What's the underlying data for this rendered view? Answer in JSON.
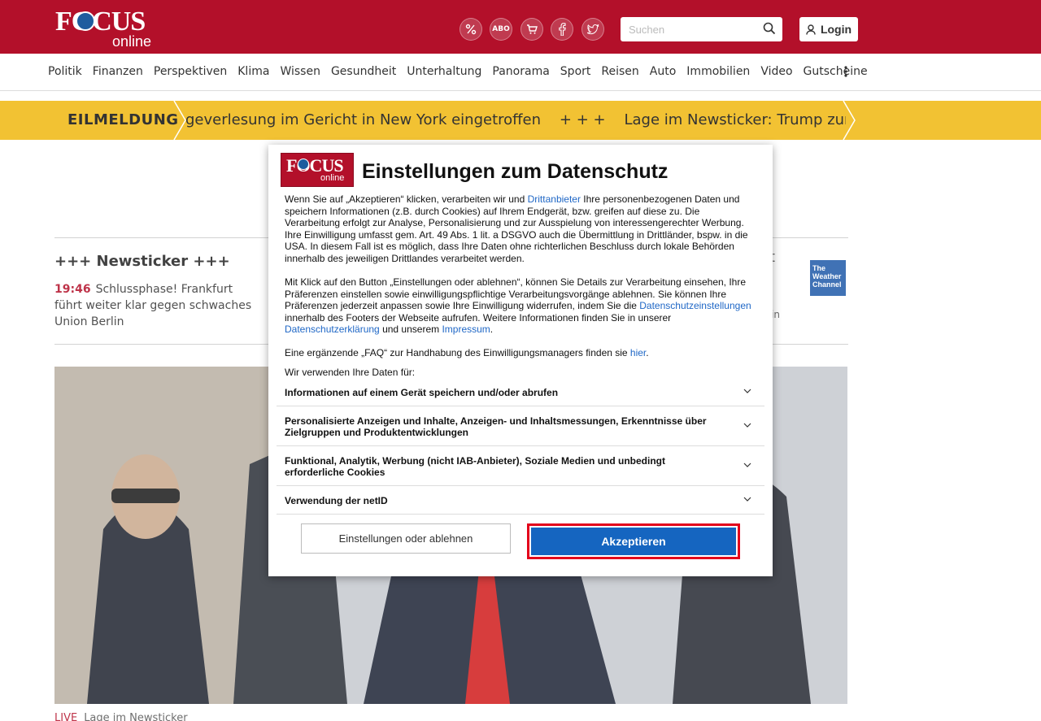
{
  "header": {
    "logo_main": "FOCUS",
    "logo_sub": "online",
    "icons": [
      {
        "name": "discount-icon",
        "glyph": "%"
      },
      {
        "name": "abo-icon",
        "glyph": "ABO"
      },
      {
        "name": "cart-icon",
        "glyph": "🛒"
      },
      {
        "name": "facebook-icon",
        "glyph": "f"
      },
      {
        "name": "twitter-icon",
        "glyph": "t"
      }
    ],
    "search_placeholder": "Suchen",
    "login_label": "Login",
    "brand_color": "#b3102a"
  },
  "nav": {
    "items": [
      "Politik",
      "Finanzen",
      "Perspektiven",
      "Klima",
      "Wissen",
      "Gesundheit",
      "Unterhaltung",
      "Panorama",
      "Sport",
      "Reisen",
      "Auto",
      "Immobilien",
      "Video",
      "Gutscheine"
    ]
  },
  "ticker": {
    "label": "EILMELDUNG",
    "text": "geverlesung im Gericht in New York eingetroffen    + + +    Lage im Newsticker: Trump zur Anklag",
    "color": "#f2c233"
  },
  "content": {
    "newsticker_heading": "+++ Newsticker +++",
    "item_time": "19:46",
    "item_text": "Schlussphase! Frankfurt führt weiter klar gegen schwaches Union Berlin",
    "weather_logo": "The Weather Channel",
    "weather_fragment": "in",
    "weather_fragment_top": "t",
    "hero_caption_label": "LIVE",
    "hero_caption_text": "Lage im Newsticker"
  },
  "modal": {
    "title": "Einstellungen zum Datenschutz",
    "p1_a": "Wenn Sie auf „Akzeptieren“ klicken, verarbeiten wir und ",
    "p1_link": "Drittanbieter",
    "p1_b": " Ihre personenbezogenen Daten und speichern Informationen (z.B. durch Cookies) auf Ihrem Endgerät, bzw. greifen auf diese zu. Die Verarbeitung erfolgt zur Analyse, Personalisierung und zur Ausspielung von interessengerechter Werbung. Ihre Einwilligung umfasst gem. Art. 49 Abs. 1 lit. a DSGVO auch die Übermittlung in Drittländer, bspw. in die USA. In diesem Fall ist es möglich, dass Ihre Daten ohne richterlichen Beschluss durch lokale Behörden innerhalb des jeweiligen Drittlandes verarbeitet werden.",
    "p2_a": "Mit Klick auf den Button „Einstellungen oder ablehnen“, können Sie Details zur Verarbeitung einsehen, Ihre Präferenzen einstellen sowie einwilligungspflichtige Verarbeitungsvorgänge ablehnen. Sie können Ihre Präferenzen jederzeit anpassen sowie Ihre Einwilligung widerrufen, indem Sie die ",
    "p2_link1": "Datenschutzeinstellungen",
    "p2_b": " innerhalb des Footers der Webseite aufrufen. Weitere Informationen finden Sie in unserer ",
    "p2_link2": "Datenschutzerklärung",
    "p2_c": " und unserem ",
    "p2_link3": "Impressum",
    "p2_d": ".",
    "p3_a": "Eine ergänzende „FAQ“ zur Handhabung des Einwilligungsmanagers finden sie ",
    "p3_link": "hier",
    "p3_b": ".",
    "purposes_intro": "Wir verwenden Ihre Daten für:",
    "purposes": [
      "Informationen auf einem Gerät speichern und/oder abrufen",
      "Personalisierte Anzeigen und Inhalte, Anzeigen- und Inhaltsmessungen, Erkenntnisse über Zielgruppen und Produktentwicklungen",
      "Funktional, Analytik, Werbung (nicht IAB-Anbieter), Soziale Medien und unbedingt erforderliche Cookies",
      "Verwendung der netID"
    ],
    "settings_button": "Einstellungen oder ablehnen",
    "accept_button": "Akzeptieren",
    "accept_color": "#1565c0",
    "highlight_color": "#e3001b"
  }
}
